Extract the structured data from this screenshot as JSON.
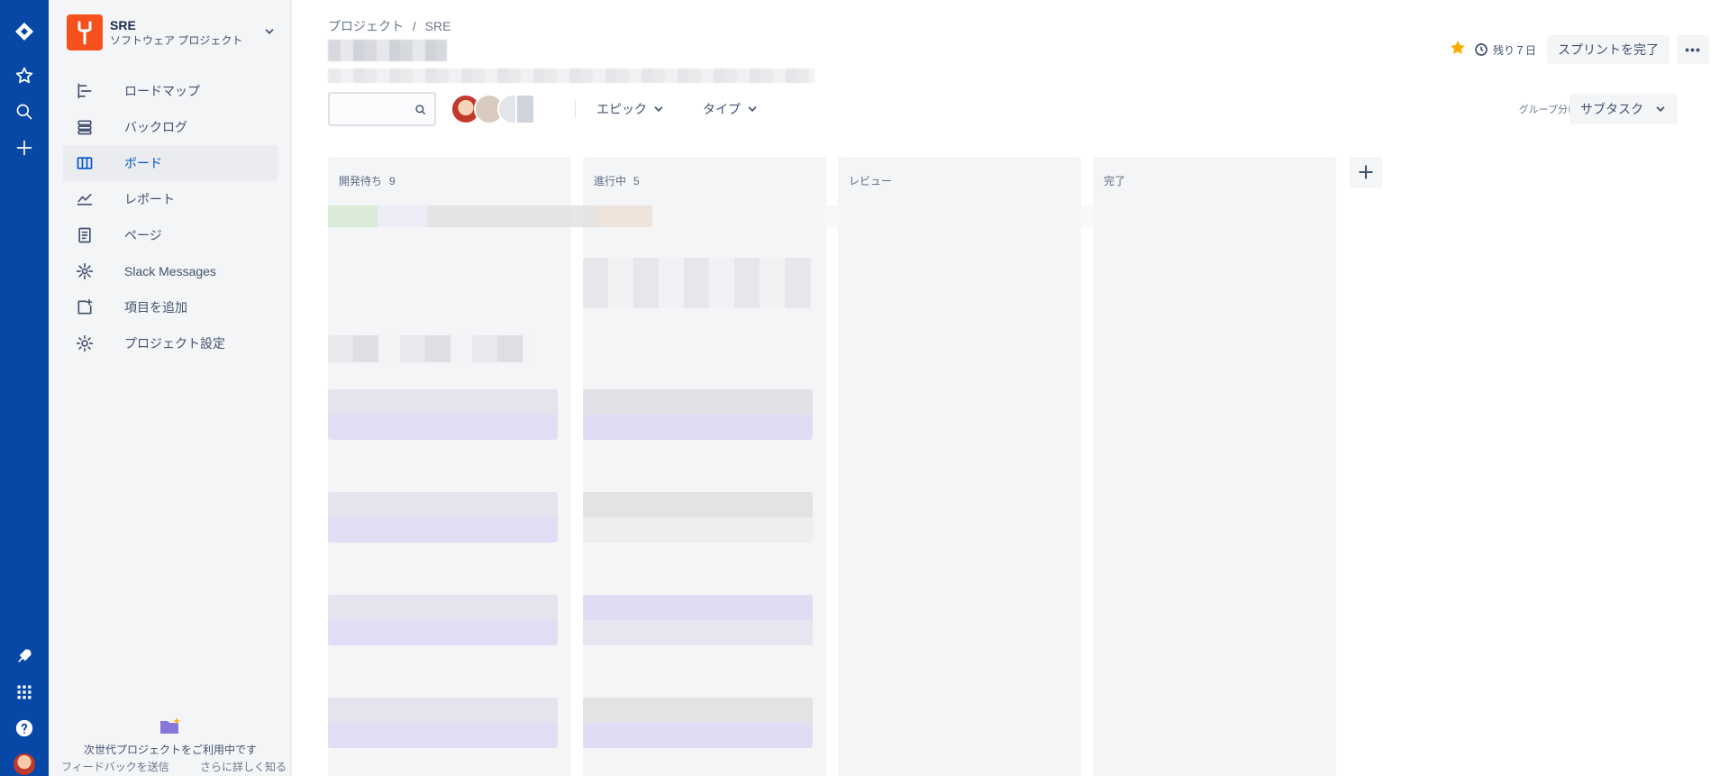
{
  "rail": {
    "icons": [
      "jira-logo-icon",
      "star-icon",
      "search-icon",
      "plus-icon",
      "rocket-icon",
      "app-switcher-icon",
      "help-icon",
      "user-avatar"
    ]
  },
  "project": {
    "name": "SRE",
    "type": "ソフトウェア プロジェクト"
  },
  "sidebar": {
    "items": [
      {
        "label": "ロードマップ",
        "icon": "roadmap-icon"
      },
      {
        "label": "バックログ",
        "icon": "backlog-icon"
      },
      {
        "label": "ボード",
        "icon": "board-icon",
        "active": true
      },
      {
        "label": "レポート",
        "icon": "reports-icon"
      },
      {
        "label": "ページ",
        "icon": "page-icon"
      },
      {
        "label": "Slack Messages",
        "icon": "slack-gear-icon"
      },
      {
        "label": "項目を追加",
        "icon": "add-item-icon"
      },
      {
        "label": "プロジェクト設定",
        "icon": "settings-icon"
      }
    ],
    "footer": {
      "message": "次世代プロジェクトをご利用中です",
      "feedback": "フィードバックを送信",
      "learn_more": "さらに詳しく知る"
    }
  },
  "breadcrumb": {
    "root": "プロジェクト",
    "separator": "/",
    "current": "SRE"
  },
  "toolbar": {
    "days_remaining": "残り７日",
    "complete_sprint": "スプリントを完了",
    "more": "•••"
  },
  "filters": {
    "search_placeholder": "",
    "epic_label": "エピック",
    "type_label": "タイプ",
    "group_by_label": "グループ分け",
    "group_by_value": "サブタスク"
  },
  "columns": [
    {
      "title": "開発待ち",
      "count": "9"
    },
    {
      "title": "進行中",
      "count": "5"
    },
    {
      "title": "レビュー",
      "count": ""
    },
    {
      "title": "完了",
      "count": ""
    }
  ],
  "colors": {
    "rail": "#0747a6",
    "accent": "#0052cc",
    "star": "#ffab00",
    "project_avatar": "#f4511e"
  }
}
